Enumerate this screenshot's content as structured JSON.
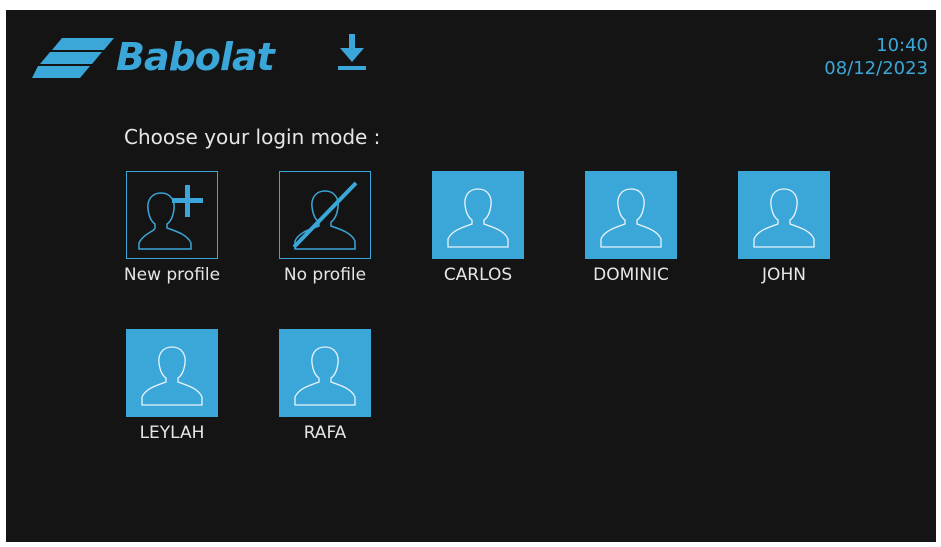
{
  "brand": {
    "name": "Babolat",
    "color": "#3ba7d9"
  },
  "header": {
    "time": "10:40",
    "date": "08/12/2023",
    "download_icon": "download-icon"
  },
  "login": {
    "prompt": "Choose your login mode :",
    "options": [
      {
        "label": "New profile",
        "icon": "add-user-icon",
        "style": "outline"
      },
      {
        "label": "No profile",
        "icon": "no-user-icon",
        "style": "outline"
      },
      {
        "label": "CARLOS",
        "icon": "user-icon",
        "style": "filled"
      },
      {
        "label": "DOMINIC",
        "icon": "user-icon",
        "style": "filled"
      },
      {
        "label": "JOHN",
        "icon": "user-icon",
        "style": "filled"
      },
      {
        "label": "LEYLAH",
        "icon": "user-icon",
        "style": "filled"
      },
      {
        "label": "RAFA",
        "icon": "user-icon",
        "style": "filled"
      }
    ]
  }
}
